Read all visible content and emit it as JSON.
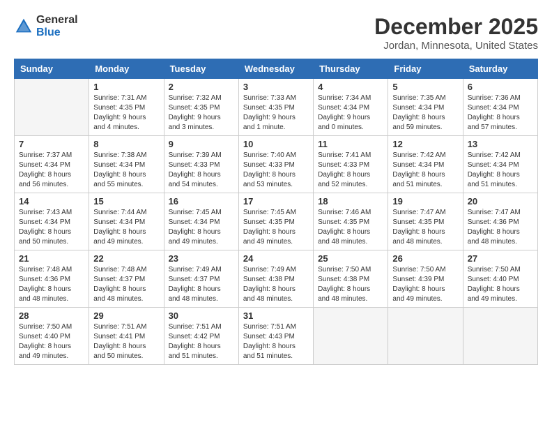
{
  "logo": {
    "line1": "General",
    "line2": "Blue"
  },
  "title": "December 2025",
  "location": "Jordan, Minnesota, United States",
  "days_of_week": [
    "Sunday",
    "Monday",
    "Tuesday",
    "Wednesday",
    "Thursday",
    "Friday",
    "Saturday"
  ],
  "weeks": [
    [
      {
        "day": "",
        "sunrise": "",
        "sunset": "",
        "daylight": "",
        "empty": true
      },
      {
        "day": "1",
        "sunrise": "Sunrise: 7:31 AM",
        "sunset": "Sunset: 4:35 PM",
        "daylight": "Daylight: 9 hours and 4 minutes."
      },
      {
        "day": "2",
        "sunrise": "Sunrise: 7:32 AM",
        "sunset": "Sunset: 4:35 PM",
        "daylight": "Daylight: 9 hours and 3 minutes."
      },
      {
        "day": "3",
        "sunrise": "Sunrise: 7:33 AM",
        "sunset": "Sunset: 4:35 PM",
        "daylight": "Daylight: 9 hours and 1 minute."
      },
      {
        "day": "4",
        "sunrise": "Sunrise: 7:34 AM",
        "sunset": "Sunset: 4:34 PM",
        "daylight": "Daylight: 9 hours and 0 minutes."
      },
      {
        "day": "5",
        "sunrise": "Sunrise: 7:35 AM",
        "sunset": "Sunset: 4:34 PM",
        "daylight": "Daylight: 8 hours and 59 minutes."
      },
      {
        "day": "6",
        "sunrise": "Sunrise: 7:36 AM",
        "sunset": "Sunset: 4:34 PM",
        "daylight": "Daylight: 8 hours and 57 minutes."
      }
    ],
    [
      {
        "day": "7",
        "sunrise": "Sunrise: 7:37 AM",
        "sunset": "Sunset: 4:34 PM",
        "daylight": "Daylight: 8 hours and 56 minutes."
      },
      {
        "day": "8",
        "sunrise": "Sunrise: 7:38 AM",
        "sunset": "Sunset: 4:34 PM",
        "daylight": "Daylight: 8 hours and 55 minutes."
      },
      {
        "day": "9",
        "sunrise": "Sunrise: 7:39 AM",
        "sunset": "Sunset: 4:33 PM",
        "daylight": "Daylight: 8 hours and 54 minutes."
      },
      {
        "day": "10",
        "sunrise": "Sunrise: 7:40 AM",
        "sunset": "Sunset: 4:33 PM",
        "daylight": "Daylight: 8 hours and 53 minutes."
      },
      {
        "day": "11",
        "sunrise": "Sunrise: 7:41 AM",
        "sunset": "Sunset: 4:33 PM",
        "daylight": "Daylight: 8 hours and 52 minutes."
      },
      {
        "day": "12",
        "sunrise": "Sunrise: 7:42 AM",
        "sunset": "Sunset: 4:34 PM",
        "daylight": "Daylight: 8 hours and 51 minutes."
      },
      {
        "day": "13",
        "sunrise": "Sunrise: 7:42 AM",
        "sunset": "Sunset: 4:34 PM",
        "daylight": "Daylight: 8 hours and 51 minutes."
      }
    ],
    [
      {
        "day": "14",
        "sunrise": "Sunrise: 7:43 AM",
        "sunset": "Sunset: 4:34 PM",
        "daylight": "Daylight: 8 hours and 50 minutes."
      },
      {
        "day": "15",
        "sunrise": "Sunrise: 7:44 AM",
        "sunset": "Sunset: 4:34 PM",
        "daylight": "Daylight: 8 hours and 49 minutes."
      },
      {
        "day": "16",
        "sunrise": "Sunrise: 7:45 AM",
        "sunset": "Sunset: 4:34 PM",
        "daylight": "Daylight: 8 hours and 49 minutes."
      },
      {
        "day": "17",
        "sunrise": "Sunrise: 7:45 AM",
        "sunset": "Sunset: 4:35 PM",
        "daylight": "Daylight: 8 hours and 49 minutes."
      },
      {
        "day": "18",
        "sunrise": "Sunrise: 7:46 AM",
        "sunset": "Sunset: 4:35 PM",
        "daylight": "Daylight: 8 hours and 48 minutes."
      },
      {
        "day": "19",
        "sunrise": "Sunrise: 7:47 AM",
        "sunset": "Sunset: 4:35 PM",
        "daylight": "Daylight: 8 hours and 48 minutes."
      },
      {
        "day": "20",
        "sunrise": "Sunrise: 7:47 AM",
        "sunset": "Sunset: 4:36 PM",
        "daylight": "Daylight: 8 hours and 48 minutes."
      }
    ],
    [
      {
        "day": "21",
        "sunrise": "Sunrise: 7:48 AM",
        "sunset": "Sunset: 4:36 PM",
        "daylight": "Daylight: 8 hours and 48 minutes."
      },
      {
        "day": "22",
        "sunrise": "Sunrise: 7:48 AM",
        "sunset": "Sunset: 4:37 PM",
        "daylight": "Daylight: 8 hours and 48 minutes."
      },
      {
        "day": "23",
        "sunrise": "Sunrise: 7:49 AM",
        "sunset": "Sunset: 4:37 PM",
        "daylight": "Daylight: 8 hours and 48 minutes."
      },
      {
        "day": "24",
        "sunrise": "Sunrise: 7:49 AM",
        "sunset": "Sunset: 4:38 PM",
        "daylight": "Daylight: 8 hours and 48 minutes."
      },
      {
        "day": "25",
        "sunrise": "Sunrise: 7:50 AM",
        "sunset": "Sunset: 4:38 PM",
        "daylight": "Daylight: 8 hours and 48 minutes."
      },
      {
        "day": "26",
        "sunrise": "Sunrise: 7:50 AM",
        "sunset": "Sunset: 4:39 PM",
        "daylight": "Daylight: 8 hours and 49 minutes."
      },
      {
        "day": "27",
        "sunrise": "Sunrise: 7:50 AM",
        "sunset": "Sunset: 4:40 PM",
        "daylight": "Daylight: 8 hours and 49 minutes."
      }
    ],
    [
      {
        "day": "28",
        "sunrise": "Sunrise: 7:50 AM",
        "sunset": "Sunset: 4:40 PM",
        "daylight": "Daylight: 8 hours and 49 minutes."
      },
      {
        "day": "29",
        "sunrise": "Sunrise: 7:51 AM",
        "sunset": "Sunset: 4:41 PM",
        "daylight": "Daylight: 8 hours and 50 minutes."
      },
      {
        "day": "30",
        "sunrise": "Sunrise: 7:51 AM",
        "sunset": "Sunset: 4:42 PM",
        "daylight": "Daylight: 8 hours and 51 minutes."
      },
      {
        "day": "31",
        "sunrise": "Sunrise: 7:51 AM",
        "sunset": "Sunset: 4:43 PM",
        "daylight": "Daylight: 8 hours and 51 minutes."
      },
      {
        "day": "",
        "sunrise": "",
        "sunset": "",
        "daylight": "",
        "empty": true
      },
      {
        "day": "",
        "sunrise": "",
        "sunset": "",
        "daylight": "",
        "empty": true
      },
      {
        "day": "",
        "sunrise": "",
        "sunset": "",
        "daylight": "",
        "empty": true
      }
    ]
  ]
}
